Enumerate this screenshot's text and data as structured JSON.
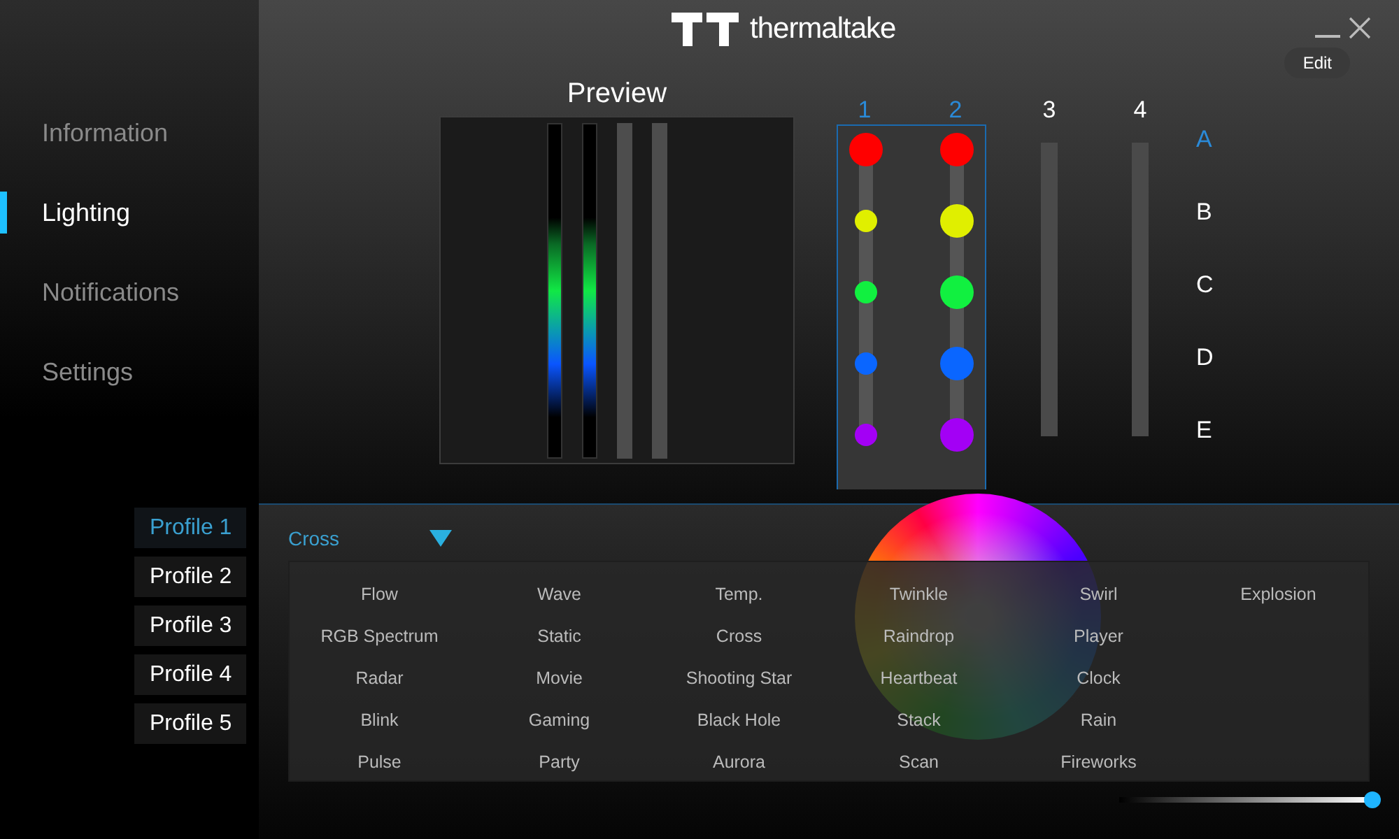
{
  "sidebar": {
    "items": [
      {
        "label": "Information",
        "selected": false
      },
      {
        "label": "Lighting",
        "selected": true
      },
      {
        "label": "Notifications",
        "selected": false
      },
      {
        "label": "Settings",
        "selected": false
      }
    ]
  },
  "profiles": [
    {
      "label": "Profile 1",
      "selected": true
    },
    {
      "label": "Profile 2",
      "selected": false
    },
    {
      "label": "Profile 3",
      "selected": false
    },
    {
      "label": "Profile 4",
      "selected": false
    },
    {
      "label": "Profile 5",
      "selected": false
    }
  ],
  "header": {
    "logo": "thermaltake",
    "edit_button": "Edit"
  },
  "preview": {
    "title": "Preview",
    "strips": [
      {
        "lit": true
      },
      {
        "lit": true
      },
      {
        "lit": false
      },
      {
        "lit": false
      }
    ]
  },
  "channels": [
    {
      "label": "1",
      "selected": true,
      "leds": [
        {
          "color": "#ff0000",
          "selected": true
        },
        {
          "color": "#e0ef00",
          "selected": false
        },
        {
          "color": "#11f040",
          "selected": false
        },
        {
          "color": "#0a66ff",
          "selected": false
        },
        {
          "color": "#a300f5",
          "selected": false
        }
      ]
    },
    {
      "label": "2",
      "selected": true,
      "leds": [
        {
          "color": "#ff0000",
          "selected": true
        },
        {
          "color": "#e0ef00",
          "selected": true
        },
        {
          "color": "#11f040",
          "selected": true
        },
        {
          "color": "#0a66ff",
          "selected": true
        },
        {
          "color": "#a300f5",
          "selected": true
        }
      ]
    },
    {
      "label": "3",
      "selected": false
    },
    {
      "label": "4",
      "selected": false
    }
  ],
  "rows": [
    {
      "label": "A",
      "selected": true
    },
    {
      "label": "B",
      "selected": false
    },
    {
      "label": "C",
      "selected": false
    },
    {
      "label": "D",
      "selected": false
    },
    {
      "label": "E",
      "selected": false
    }
  ],
  "effect_dropdown": {
    "value": "Cross",
    "expanded": true,
    "options": [
      [
        "Flow",
        "Wave",
        "Temp.",
        "Twinkle",
        "Swirl",
        "Explosion"
      ],
      [
        "RGB Spectrum",
        "Static",
        "Cross",
        "Raindrop",
        "Player"
      ],
      [
        "Radar",
        "Movie",
        "Shooting Star",
        "Heartbeat",
        "Clock"
      ],
      [
        "Blink",
        "Gaming",
        "Black Hole",
        "Stack",
        "Rain"
      ],
      [
        "Pulse",
        "Party",
        "Aurora",
        "Scan",
        "Fireworks"
      ]
    ]
  },
  "brightness": {
    "level": 1
  }
}
